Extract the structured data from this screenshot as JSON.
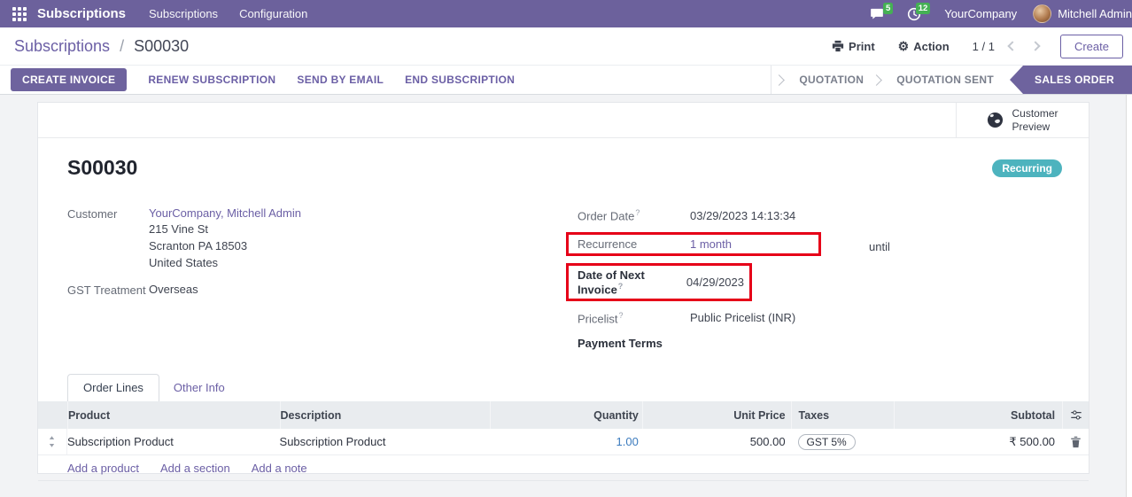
{
  "navbar": {
    "app_name": "Subscriptions",
    "menu_items": {
      "0": "Subscriptions",
      "1": "Configuration"
    },
    "messages_badge": "5",
    "activities_badge": "12",
    "company": "YourCompany",
    "user": "Mitchell Admin"
  },
  "control_panel": {
    "breadcrumb_parent": "Subscriptions",
    "breadcrumb_separator": "/",
    "breadcrumb_current": "S00030",
    "print_label": "Print",
    "action_label": "Action",
    "gear_glyph": "⚙",
    "pager": "1 / 1",
    "create_label": "Create"
  },
  "statusbar": {
    "buttons": {
      "create_invoice": "CREATE INVOICE",
      "renew": "RENEW SUBSCRIPTION",
      "send_email": "SEND BY EMAIL",
      "end": "END SUBSCRIPTION"
    },
    "stages": {
      "0": {
        "label": "QUOTATION"
      },
      "1": {
        "label": "QUOTATION SENT"
      },
      "2": {
        "label": "SALES ORDER"
      }
    }
  },
  "sheet": {
    "preview_line1": "Customer",
    "preview_line2": "Preview",
    "badge": "Recurring",
    "title": "S00030",
    "help_marker": "?",
    "customer": {
      "label": "Customer",
      "name": "YourCompany, Mitchell Admin",
      "address_line1": "215 Vine St",
      "address_line2": "Scranton PA 18503",
      "address_line3": "United States"
    },
    "gst": {
      "label": "GST Treatment",
      "value": "Overseas"
    },
    "fields": {
      "order_date": {
        "label": "Order Date",
        "value": "03/29/2023 14:13:34"
      },
      "recurrence": {
        "label": "Recurrence",
        "value": "1 month",
        "suffix": "until"
      },
      "next_invoice": {
        "label": "Date of Next Invoice",
        "value": "04/29/2023"
      },
      "pricelist": {
        "label": "Pricelist",
        "value": "Public Pricelist (INR)"
      },
      "payment_terms": {
        "label": "Payment Terms"
      }
    }
  },
  "tabs": {
    "0": {
      "label": "Order Lines"
    },
    "1": {
      "label": "Other Info"
    }
  },
  "table": {
    "headers": {
      "product": "Product",
      "description": "Description",
      "quantity": "Quantity",
      "unit_price": "Unit Price",
      "taxes": "Taxes",
      "subtotal": "Subtotal"
    },
    "rows": {
      "0": {
        "product": "Subscription Product",
        "description": "Subscription Product",
        "quantity": "1.00",
        "unit_price": "500.00",
        "taxes": "GST 5%",
        "subtotal": "₹ 500.00"
      }
    },
    "footer_links": {
      "0": "Add a product",
      "1": "Add a section",
      "2": "Add a note"
    }
  },
  "colors": {
    "navbar_purple": "#6c619c",
    "accent_purple": "#6b5fa5",
    "recurring_teal": "#4db3be",
    "badge_green": "#45b154",
    "highlight_red": "#e60018",
    "quantity_blue": "#3b7bbe"
  }
}
